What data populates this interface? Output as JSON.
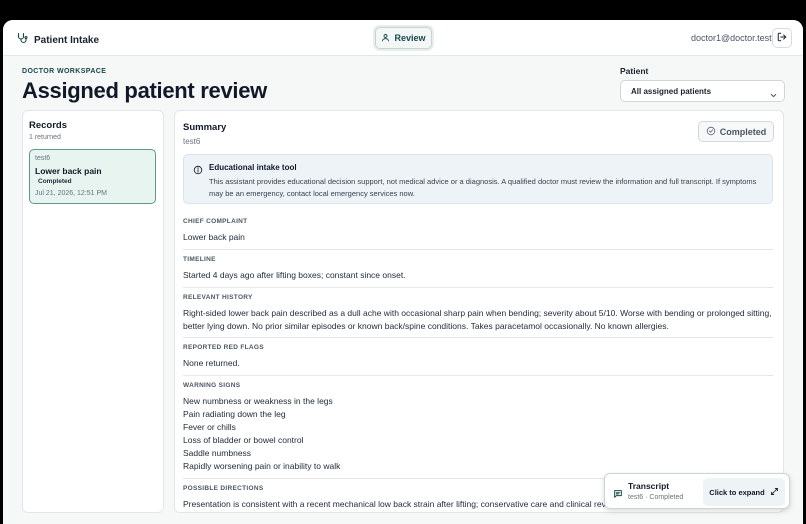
{
  "app": {
    "name": "Patient Intake",
    "nav_review": "Review",
    "user_email": "doctor1@doctor.test",
    "accent_color": "#17494a",
    "icons": {
      "brand": "stethoscope-icon",
      "review": "user-icon",
      "logout": "logout-icon",
      "chevron": "chevron-down-icon",
      "status": "check-circle-icon",
      "info": "info-icon",
      "transcript": "chat-icon",
      "expand": "expand-icon"
    }
  },
  "page": {
    "eyebrow": "DOCTOR WORKSPACE",
    "title": "Assigned patient review",
    "patient_filter": {
      "label": "Patient",
      "selected": "All assigned patients"
    }
  },
  "records": {
    "title": "Records",
    "count": "1 returned",
    "items": [
      {
        "id": "test6",
        "title": "Lower back pain",
        "status": "Completed",
        "date": "Jul 21, 2026, 12:51 PM"
      }
    ]
  },
  "summary": {
    "title": "Summary",
    "subtitle": "test6",
    "status": "Completed",
    "notice": {
      "title": "Educational intake tool",
      "body": "This assistant provides educational decision support, not medical advice or a diagnosis. A qualified doctor must review the information and full transcript. If symptoms may be an emergency, contact local emergency services now."
    },
    "sections": {
      "chief_complaint": {
        "label": "CHIEF COMPLAINT",
        "text": "Lower back pain"
      },
      "timeline": {
        "label": "TIMELINE",
        "text": "Started 4 days ago after lifting boxes; constant since onset."
      },
      "relevant_history": {
        "label": "RELEVANT HISTORY",
        "text": "Right-sided lower back pain described as a dull ache with occasional sharp pain when bending; severity about 5/10. Worse with bending or prolonged sitting, better lying down. No prior similar episodes or known back/spine conditions. Takes paracetamol occasionally. No known allergies."
      },
      "red_flags": {
        "label": "REPORTED RED FLAGS",
        "text": "None returned."
      },
      "warning_signs": {
        "label": "WARNING SIGNS",
        "items": [
          "New numbness or weakness in the legs",
          "Pain radiating down the leg",
          "Fever or chills",
          "Loss of bladder or bowel control",
          "Saddle numbness",
          "Rapidly worsening pain or inability to walk"
        ]
      },
      "possible_directions": {
        "label": "POSSIBLE DIRECTIONS",
        "text": "Presentation is consistent with a recent mechanical low back strain after lifting; conservative care and clinical review recommended."
      }
    }
  },
  "transcript": {
    "title": "Transcript",
    "subtitle": "test6 · Completed",
    "expand_label": "Click to expand"
  }
}
